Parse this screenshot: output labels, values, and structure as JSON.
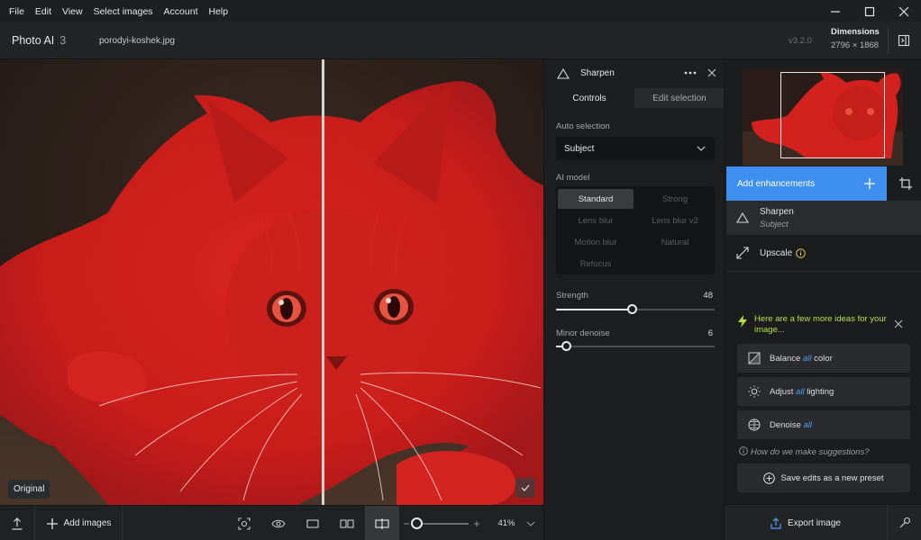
{
  "menubar": {
    "items": [
      "File",
      "Edit",
      "View",
      "Select images",
      "Account",
      "Help"
    ]
  },
  "window": {
    "minimize": "—",
    "maximize": "☐",
    "close": "✕"
  },
  "titlebar": {
    "app_name": "Photo AI",
    "image_count": "3",
    "filename": "porodyi-koshek.jpg",
    "version": "v3.2.0",
    "dimensions_label": "Dimensions",
    "dimensions_value": "2796 × 1868"
  },
  "canvas": {
    "original_label": "Original",
    "mask_color": "#e0201d"
  },
  "bottombar": {
    "add_images": "Add images",
    "zoom": "41%"
  },
  "tool_panel": {
    "title": "Sharpen",
    "tabs": [
      "Controls",
      "Edit selection"
    ],
    "auto_selection_label": "Auto selection",
    "auto_selection_value": "Subject",
    "ai_model_label": "AI model",
    "models": [
      "Standard",
      "Strong",
      "Lens blur",
      "Lens blur v2",
      "Motion blur",
      "Natural",
      "Refocus"
    ],
    "selected_model": "Standard",
    "strength_label": "Strength",
    "strength_value": "48",
    "minor_denoise_label": "Minor denoise",
    "minor_denoise_value": "6"
  },
  "right_panel": {
    "add_enhancements": "Add enhancements",
    "enhancements": [
      {
        "name": "Sharpen",
        "sub": "Subject"
      },
      {
        "name": "Upscale",
        "sub": ""
      }
    ],
    "ideas_title": "Here are a few more ideas for your image...",
    "ideas": [
      {
        "pre": "Balance ",
        "em": "all",
        "post": " color"
      },
      {
        "pre": "Adjust ",
        "em": "all",
        "post": " lighting"
      },
      {
        "pre": "Denoise ",
        "em": "all",
        "post": ""
      }
    ],
    "how_suggest": "How do we make suggestions?",
    "save_preset": "Save edits as a new preset",
    "export": "Export image"
  },
  "colors": {
    "accent_blue": "#3f8ff0",
    "idea_green": "#b7e03a"
  }
}
